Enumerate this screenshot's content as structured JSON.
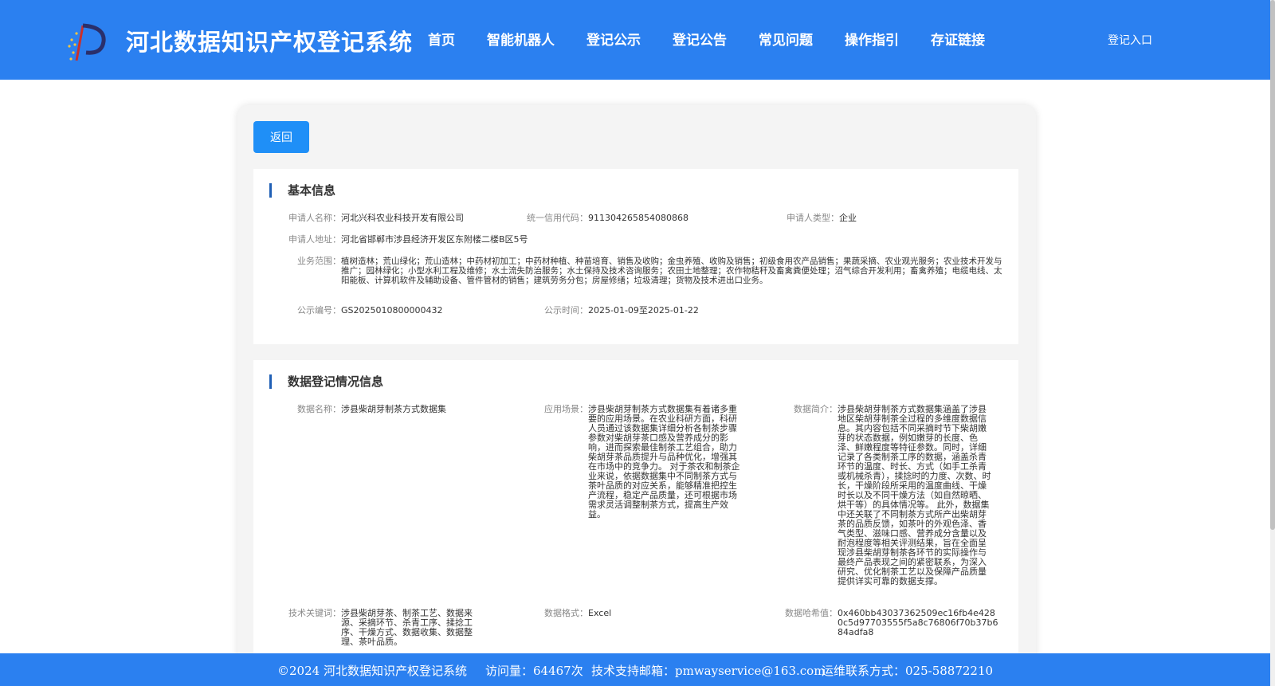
{
  "header": {
    "title": "河北数据知识产权登记系统",
    "nav": [
      "首页",
      "智能机器人",
      "登记公示",
      "登记公告",
      "常见问题",
      "操作指引",
      "存证链接"
    ],
    "login": "登记入口"
  },
  "back_label": "返回",
  "basic": {
    "title": "基本信息",
    "applicant_name_label": "申请人名称：",
    "applicant_name": "河北兴科农业科技开发有限公司",
    "credit_code_label": "统一信用代码：",
    "credit_code": "911304265854080868",
    "applicant_type_label": "申请人类型：",
    "applicant_type": "企业",
    "address_label": "申请人地址：",
    "address": "河北省邯郸市涉县经济开发区东附楼二楼B区5号",
    "scope_label": "业务范围：",
    "scope": "植树造林；荒山绿化；荒山造林；中药材初加工；中药材种植、种苗培育、销售及收购；金虫养殖、收购及销售；初级食用农产品销售；果蔬采摘、农业观光服务；农业技术开发与推广；园林绿化；小型水利工程及维修；水土流失防治服务；水土保持及技术咨询服务；农田土地整理；农作物秸秆及畜禽粪便处理；沼气综合开发利用；畜禽养殖；电缆电线、太阳能板、计算机软件及辅助设备、管件管材的销售；建筑劳务分包；房屋修缮；垃圾清理；货物及技术进出口业务。",
    "pub_no_label": "公示编号：",
    "pub_no": "GS2025010800000432",
    "pub_time_label": "公示时间：",
    "pub_time": "2025-01-09至2025-01-22"
  },
  "reg": {
    "title": "数据登记情况信息",
    "name_label": "数据名称：",
    "name": "涉县柴胡芽制茶方式数据集",
    "scene_label": "应用场景：",
    "scene": "涉县柴胡芽制茶方式数据集有着诸多重要的应用场景。在农业科研方面，科研人员通过该数据集详细分析各制茶步骤参数对柴胡芽茶口感及营养成分的影响，进而探索最佳制茶工艺组合，助力柴胡芽茶品质提升与品种优化，增强其在市场中的竞争力。 对于茶农和制茶企业来说，依据数据集中不同制茶方式与茶叶品质的对应关系，能够精准把控生产流程，稳定产品质量，还可根据市场需求灵活调整制茶方式，提高生产效益。",
    "intro_label": "数据简介：",
    "intro": "涉县柴胡芽制茶方式数据集涵盖了涉县地区柴胡芽制茶全过程的多维度数据信息。其内容包括不同采摘时节下柴胡嫩芽的状态数据，例如嫩芽的长度、色泽、鲜嫩程度等特征参数。同时，详细记录了各类制茶工序的数据，涵盖杀青环节的温度、时长、方式（如手工杀青或机械杀青），揉捻时的力度、次数、时长，干燥阶段所采用的温度曲线、干燥时长以及不同干燥方法（如自然晾晒、烘干等）的具体情况等。 此外，数据集中还关联了不同制茶方式所产出柴胡芽茶的品质反馈，如茶叶的外观色泽、香气类型、滋味口感、营养成分含量以及耐泡程度等相关评测结果，旨在全面呈现涉县柴胡芽制茶各环节的实际操作与最终产品表现之间的紧密联系，为深入研究、优化制茶工艺以及保障产品质量提供详实可靠的数据支撑。",
    "keywords_label": "技术关键词：",
    "keywords": "涉县柴胡芽茶、制茶工艺、数据来源、采摘环节、杀青工序、揉捻工序、干燥方式、数据收集、数据整理、茶叶品质。",
    "format_label": "数据格式：",
    "format": "Excel",
    "hash_label": "数据哈希值：",
    "hash": "0x460bb43037362509ec16fb4e4280c5d97703555f5a8c76806f70b37b684adfa8"
  },
  "footer": {
    "copyright": "©2024 河北数据知识产权登记系统",
    "visits": "访问量：64467次",
    "email": "技术支持邮箱：pmwayservice@163.com",
    "phone": "运维联系方式：025-58872210"
  }
}
